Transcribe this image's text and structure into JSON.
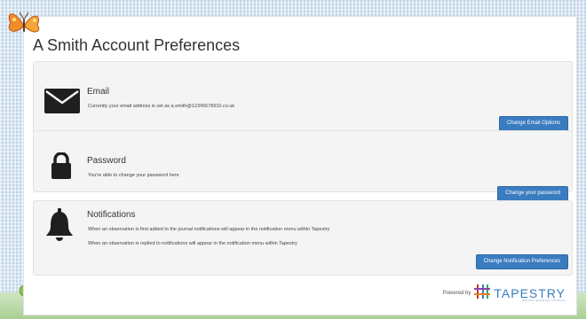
{
  "page": {
    "title": "A Smith Account Preferences"
  },
  "email": {
    "icon": "envelope-icon",
    "title": "Email",
    "text": "Currently your email address is set as a.smith@12345678910.co.uk",
    "button_label": "Change Email Options"
  },
  "password": {
    "icon": "padlock-icon",
    "title": "Password",
    "text": "You're able to change your password here",
    "button_label": "Change your password"
  },
  "notifications": {
    "icon": "bell-icon",
    "title": "Notifications",
    "text_1": "When an observation is first added to the journal notifications will appear in the notification menu within Tapestry",
    "text_2": "When an observation is replied to notifications will appear in the notification menu within Tapestry",
    "button_label": "Change Notification Preferences"
  },
  "footer": {
    "powered_by": "Powered by",
    "brand": "TAPESTRY",
    "tagline": "ONLINE LEARNING JOURNAL"
  },
  "colors": {
    "button": "#3a7cc0",
    "brand": "#3a7cc0",
    "card_background": "#f4f4f4",
    "page_background": "#bcd2e6"
  }
}
